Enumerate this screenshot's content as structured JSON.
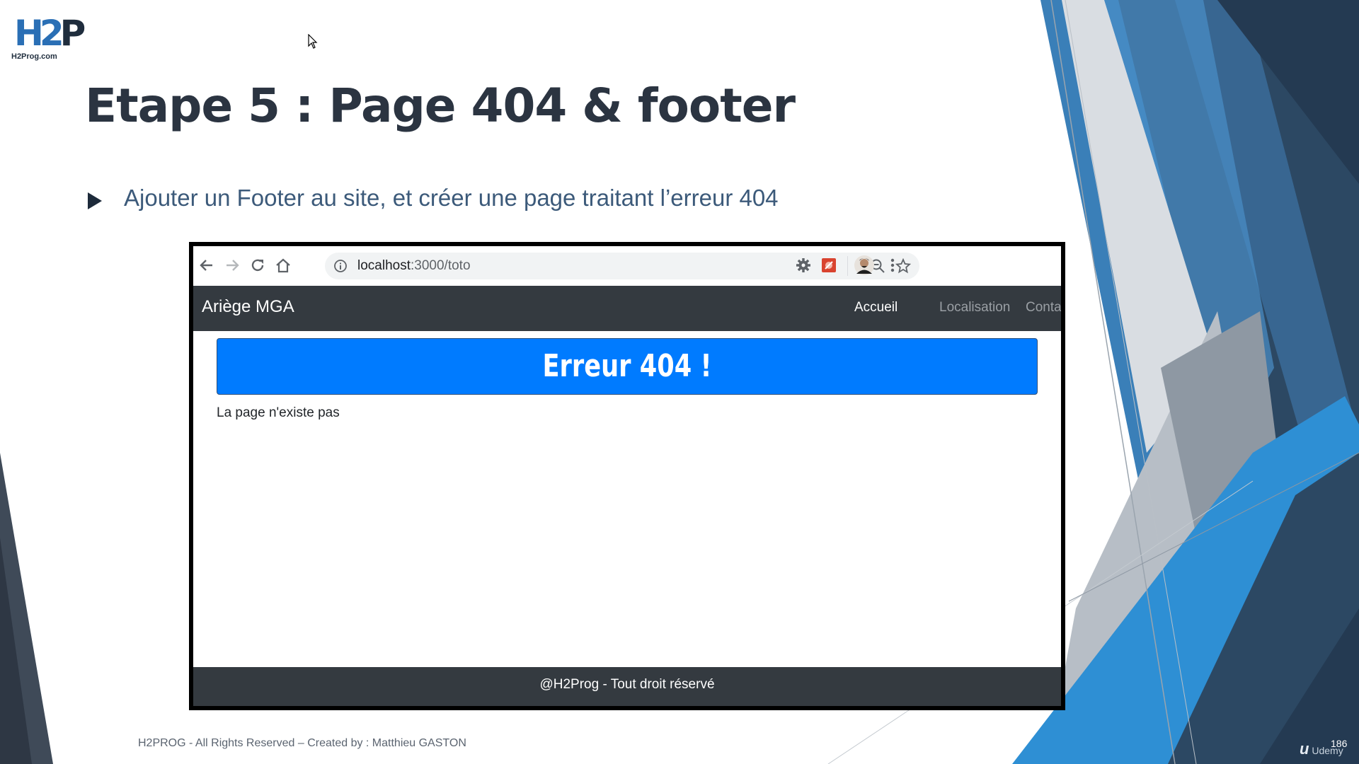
{
  "slide": {
    "title": "Etape 5 : Page 404 & footer",
    "bullet": "Ajouter un Footer au site, et créer une page traitant l’erreur 404",
    "footer": "H2PROG - All Rights Reserved – Created by : Matthieu GASTON",
    "page_number": "186"
  },
  "logo": {
    "mark_letter_1": "H",
    "mark_digit": "2",
    "mark_letter_2": "P",
    "site": "H2Prog.com"
  },
  "browser": {
    "url_host": "localhost",
    "url_path": ":3000/toto",
    "toolbar_icons": [
      "back-icon",
      "forward-icon",
      "reload-icon",
      "home-icon",
      "info-icon",
      "zoom-out-icon",
      "bookmark-star-icon",
      "extension-gear-icon",
      "extension-red-icon",
      "profile-avatar",
      "menu-icon"
    ]
  },
  "site": {
    "brand": "Ariège MGA",
    "nav": {
      "home": "Accueil",
      "location": "Localisation",
      "contact": "Contact"
    },
    "error_banner": "Erreur 404 !",
    "message": "La page n'existe pas",
    "footer": "@H2Prog - Tout droit réservé"
  },
  "watermark": "Udemy",
  "colors": {
    "navbar": "#343a40",
    "banner": "#007bff",
    "accent_blue": "#3a8fd0",
    "dark_navy": "#2c3e55",
    "title": "#2b3441",
    "bullet_text": "#3c5a7a"
  }
}
